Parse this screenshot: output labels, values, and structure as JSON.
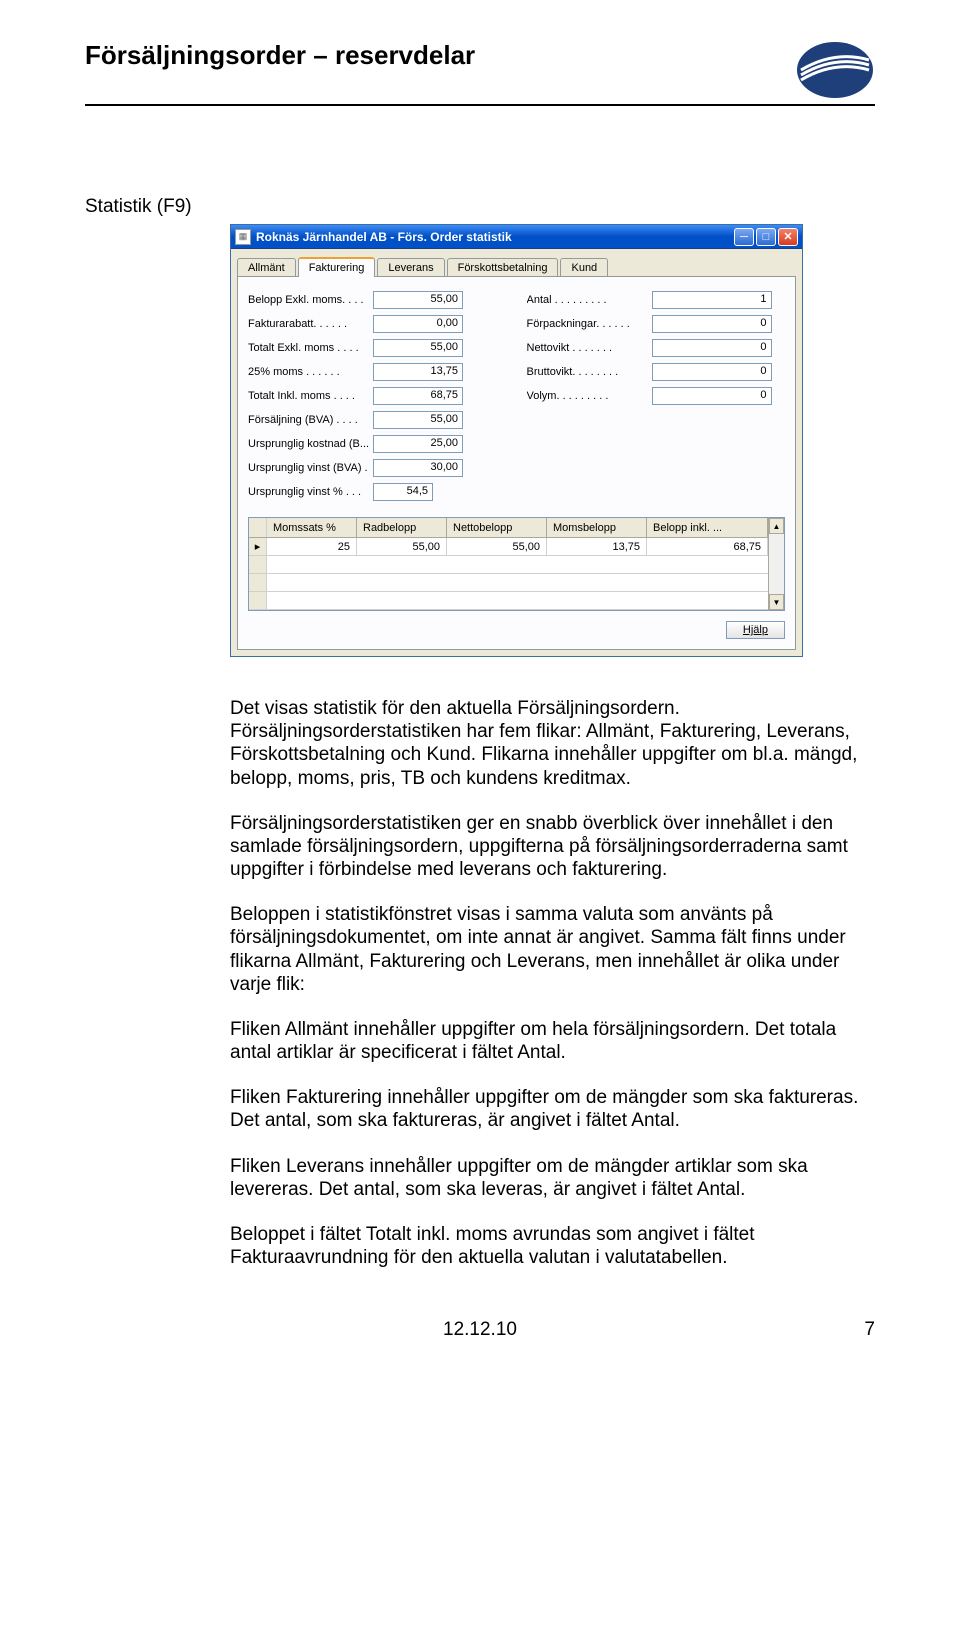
{
  "header": {
    "title": "Försäljningsorder – reservdelar"
  },
  "section_label": "Statistik (F9)",
  "window": {
    "title": "Roknäs Järnhandel AB - Förs. Order statistik",
    "tabs": [
      "Allmänt",
      "Fakturering",
      "Leverans",
      "Förskottsbetalning",
      "Kund"
    ],
    "active_tab": "Fakturering",
    "left_fields": [
      {
        "label": "Belopp Exkl. moms.  .  .  .",
        "value": "55,00"
      },
      {
        "label": "Fakturarabatt.  .  .  .  .  .",
        "value": "0,00"
      },
      {
        "label": "Totalt Exkl. moms  .  .  .  .",
        "value": "55,00"
      },
      {
        "label": "25% moms  .  .  .  .  .  .",
        "value": "13,75"
      },
      {
        "label": "Totalt Inkl. moms  .  .  .  .",
        "value": "68,75"
      },
      {
        "label": "Försäljning (BVA)  .  .  .  .",
        "value": "55,00"
      },
      {
        "label": "Ursprunglig kostnad (B...",
        "value": "25,00"
      },
      {
        "label": "Ursprunglig vinst (BVA)  .",
        "value": "30,00"
      },
      {
        "label": "Ursprunglig vinst %  .  .  .",
        "value": "54,5"
      }
    ],
    "right_fields": [
      {
        "label": "Antal  .  .  .  .  .  .  .  .  .",
        "value": "1"
      },
      {
        "label": "Förpackningar.  .  .  .  .  .",
        "value": "0"
      },
      {
        "label": "Nettovikt  .  .  .  .  .  .  .",
        "value": "0"
      },
      {
        "label": "Bruttovikt.  .  .  .  .  .  .  .",
        "value": "0"
      },
      {
        "label": "Volym.  .  .  .  .  .  .  .  .",
        "value": "0"
      }
    ],
    "grid": {
      "headers": [
        "Momssats %",
        "Radbelopp",
        "Nettobelopp",
        "Momsbelopp",
        "Belopp inkl. ..."
      ],
      "rows": [
        [
          "25",
          "55,00",
          "55,00",
          "13,75",
          "68,75"
        ]
      ]
    },
    "help_label": "Hjälp"
  },
  "body": {
    "p1": "Det visas statistik för den aktuella Försäljningsordern. Försäljningsorderstatistiken har fem flikar: Allmänt, Fakturering, Leverans, Förskottsbetalning och Kund. Flikarna innehåller uppgifter om bl.a. mängd, belopp, moms, pris, TB och kundens kreditmax.",
    "p2": "Försäljningsorderstatistiken ger en snabb överblick över innehållet i den samlade försäljningsordern, uppgifterna på försäljningsorderraderna samt uppgifter i förbindelse med leverans och fakturering.",
    "p3": "Beloppen i statistikfönstret visas i samma valuta som använts på försäljningsdokumentet, om inte annat är angivet. Samma fält finns under flikarna Allmänt, Fakturering och Leverans, men innehållet är olika under varje flik:",
    "p4": "Fliken Allmänt innehåller uppgifter om hela försäljningsordern. Det totala antal artiklar är specificerat i fältet Antal.",
    "p5": "Fliken Fakturering innehåller uppgifter om de mängder som ska faktureras. Det antal, som ska faktureras, är angivet i fältet Antal.",
    "p6": "Fliken Leverans innehåller uppgifter om de mängder artiklar som ska levereras. Det antal, som ska leveras, är angivet i fältet Antal.",
    "p7": "Beloppet i fältet Totalt inkl. moms avrundas som angivet i fältet Fakturaavrundning för den aktuella valutan i valutatabellen."
  },
  "footer": {
    "date": "12.12.10",
    "page": "7"
  }
}
